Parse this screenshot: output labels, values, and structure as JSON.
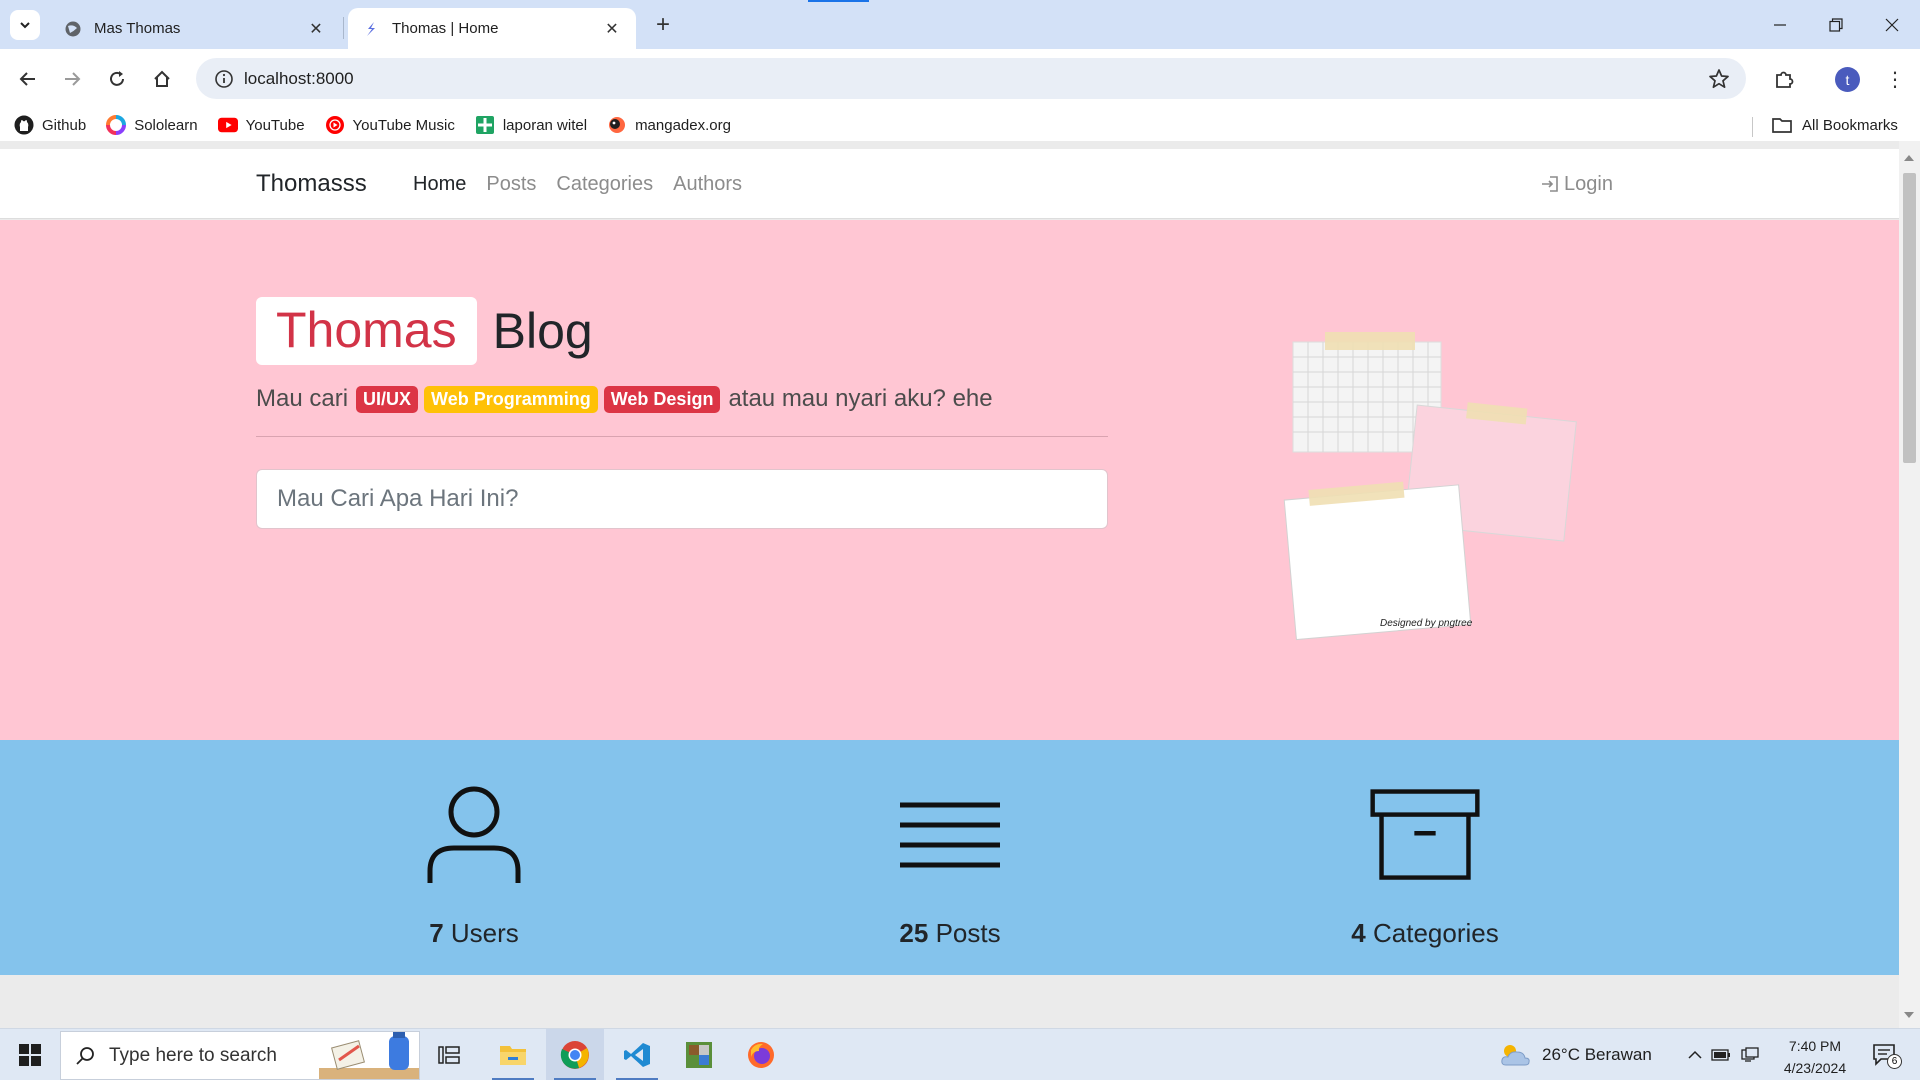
{
  "browser": {
    "tabs": [
      {
        "title": "Mas Thomas",
        "icon": "globe-icon",
        "active": false
      },
      {
        "title": "Thomas | Home",
        "icon": "pen-logo-icon",
        "active": true
      }
    ],
    "address": "localhost:8000",
    "profile_initial": "t",
    "bookmarks": [
      {
        "label": "Github",
        "icon": "github-icon"
      },
      {
        "label": "Sololearn",
        "icon": "sololearn-icon"
      },
      {
        "label": "YouTube",
        "icon": "youtube-icon"
      },
      {
        "label": "YouTube Music",
        "icon": "youtube-music-icon"
      },
      {
        "label": "laporan witel",
        "icon": "sheets-icon"
      },
      {
        "label": "mangadex.org",
        "icon": "mangadex-icon"
      }
    ],
    "all_bookmarks": "All Bookmarks"
  },
  "site": {
    "brand": "Thomasss",
    "menu": [
      {
        "label": "Home",
        "active": true
      },
      {
        "label": "Posts",
        "active": false
      },
      {
        "label": "Categories",
        "active": false
      },
      {
        "label": "Authors",
        "active": false
      }
    ],
    "login": "Login"
  },
  "hero": {
    "title_highlight": "Thomas",
    "title_rest": "Blog",
    "subtitle_prefix": "Mau cari",
    "badges": [
      {
        "label": "UI/UX",
        "color": "#dc3545"
      },
      {
        "label": "Web Programming",
        "color": "#ffc107"
      },
      {
        "label": "Web Design",
        "color": "#dc3545"
      }
    ],
    "subtitle_suffix": "atau mau nyari aku? ehe",
    "search_placeholder": "Mau Cari Apa Hari Ini?",
    "illustration_credit": "Designed by pngtree"
  },
  "stats": [
    {
      "count": "7",
      "label": "Users",
      "icon": "user-icon"
    },
    {
      "count": "25",
      "label": "Posts",
      "icon": "lines-icon"
    },
    {
      "count": "4",
      "label": "Categories",
      "icon": "archive-box-icon"
    }
  ],
  "taskbar": {
    "search_placeholder": "Type here to search",
    "weather": "26°C  Berawan",
    "time": "7:40 PM",
    "date": "4/23/2024",
    "notification_count": "6"
  },
  "colors": {
    "hero_bg": "#ffc6d3",
    "stats_bg": "#84c3ec",
    "brand_red": "#d23347"
  }
}
